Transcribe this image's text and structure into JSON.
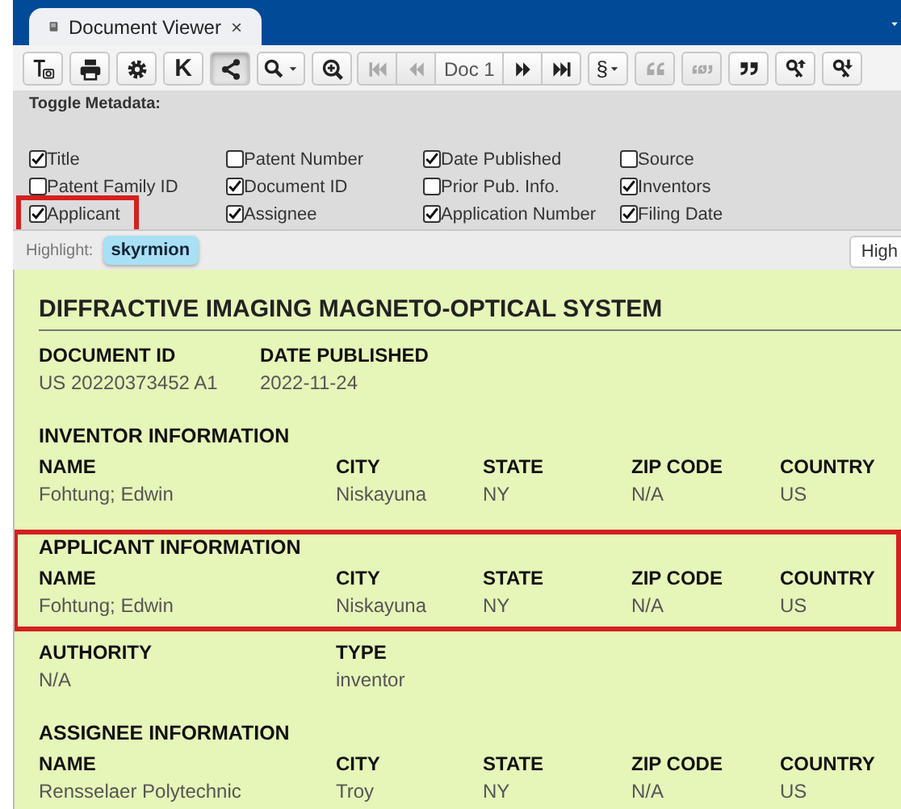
{
  "tab": {
    "title": "Document Viewer",
    "close": "×"
  },
  "toolbar": [
    {
      "kind": "text-image",
      "disabled": false,
      "selected": false
    },
    {
      "kind": "print",
      "disabled": false,
      "selected": false
    },
    {
      "kind": "settings",
      "disabled": false,
      "selected": false
    },
    {
      "kind": "letter",
      "label": "K",
      "disabled": false,
      "selected": false
    },
    {
      "kind": "share",
      "disabled": false,
      "selected": true
    },
    {
      "kind": "search-menu",
      "disabled": false,
      "selected": false
    },
    {
      "kind": "zoom",
      "disabled": false,
      "selected": false
    },
    {
      "kind": "first",
      "disabled": true,
      "selected": false
    },
    {
      "kind": "previous",
      "disabled": true,
      "selected": false
    },
    {
      "kind": "doc",
      "label": "Doc 1",
      "disabled": false,
      "selected": false
    },
    {
      "kind": "next",
      "disabled": false,
      "selected": false
    },
    {
      "kind": "last",
      "disabled": false,
      "selected": false
    },
    {
      "kind": "letter-menu",
      "label": "§",
      "disabled": false,
      "selected": false
    },
    {
      "kind": "quote-open",
      "disabled": true,
      "selected": false
    },
    {
      "kind": "quote-both",
      "disabled": true,
      "selected": false
    },
    {
      "kind": "quote-close",
      "disabled": false,
      "selected": false
    },
    {
      "kind": "key-up",
      "disabled": false,
      "selected": false
    },
    {
      "kind": "key-down",
      "disabled": false,
      "selected": false
    }
  ],
  "metadata": {
    "heading": "Toggle Metadata:",
    "options": [
      {
        "label": "Title",
        "checked": true,
        "annotated": false
      },
      {
        "label": "Patent Number",
        "checked": false,
        "annotated": false
      },
      {
        "label": "Date Published",
        "checked": true,
        "annotated": false
      },
      {
        "label": "Source",
        "checked": false,
        "annotated": false
      },
      {
        "label": "Patent Family ID",
        "checked": false,
        "annotated": false
      },
      {
        "label": "Document ID",
        "checked": true,
        "annotated": false
      },
      {
        "label": "Prior Pub. Info.",
        "checked": false,
        "annotated": false
      },
      {
        "label": "Inventors",
        "checked": true,
        "annotated": false
      },
      {
        "label": "Applicant",
        "checked": true,
        "annotated": true
      },
      {
        "label": "Assignee",
        "checked": true,
        "annotated": false
      },
      {
        "label": "Application Number",
        "checked": true,
        "annotated": false
      },
      {
        "label": "Filing Date",
        "checked": true,
        "annotated": false
      }
    ]
  },
  "highlight": {
    "label": "Highlight:",
    "terms": [
      "skyrmion"
    ],
    "button": "High"
  },
  "document": {
    "title": "DIFFRACTIVE IMAGING MAGNETO-OPTICAL SYSTEM",
    "blocks": [
      {
        "kind": "pairs",
        "annotated": false,
        "fields": [
          {
            "label": "DOCUMENT ID",
            "value": "US 20220373452 A1"
          },
          {
            "label": "DATE PUBLISHED",
            "value": "2022-11-24"
          }
        ]
      },
      {
        "kind": "table",
        "annotated": false,
        "heading": "INVENTOR INFORMATION",
        "columns": [
          "NAME",
          "CITY",
          "STATE",
          "ZIP CODE",
          "COUNTRY"
        ],
        "rows": [
          [
            "Fohtung; Edwin",
            "Niskayuna",
            "NY",
            "N/A",
            "US"
          ]
        ]
      },
      {
        "kind": "table",
        "annotated": true,
        "heading": "APPLICANT INFORMATION",
        "columns": [
          "NAME",
          "CITY",
          "STATE",
          "ZIP CODE",
          "COUNTRY"
        ],
        "rows": [
          [
            "Fohtung; Edwin",
            "Niskayuna",
            "NY",
            "N/A",
            "US"
          ]
        ]
      },
      {
        "kind": "table",
        "annotated": false,
        "columns": [
          "AUTHORITY",
          "TYPE"
        ],
        "rows": [
          [
            "N/A",
            "inventor"
          ]
        ]
      },
      {
        "kind": "table",
        "annotated": false,
        "heading": "ASSIGNEE INFORMATION",
        "columns": [
          "NAME",
          "CITY",
          "STATE",
          "ZIP CODE",
          "COUNTRY"
        ],
        "rows": [
          [
            "Rensselaer Polytechnic",
            "Troy",
            "NY",
            "N/A",
            "US"
          ]
        ]
      }
    ]
  }
}
